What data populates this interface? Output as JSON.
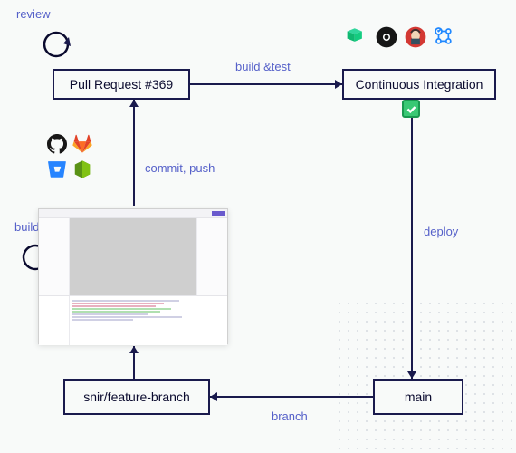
{
  "nodes": {
    "pr": "Pull Request #369",
    "ci": "Continuous Integration",
    "feature": "snir/feature-branch",
    "main": "main"
  },
  "labels": {
    "review": "review",
    "build": "build",
    "commit_push": "commit, push",
    "build_test": "build &test",
    "deploy": "deploy",
    "branch": "branch"
  },
  "icons": {
    "repo_hosts": [
      "github-icon",
      "gitlab-icon",
      "bitbucket-icon",
      "aws-codecommit-icon"
    ],
    "ci_tools": [
      "buildkite-icon",
      "circleci-icon",
      "jenkins-icon",
      "github-actions-icon"
    ]
  },
  "colors": {
    "stroke": "#1a1a4d",
    "label": "#5560c9",
    "check": "#39c874"
  }
}
